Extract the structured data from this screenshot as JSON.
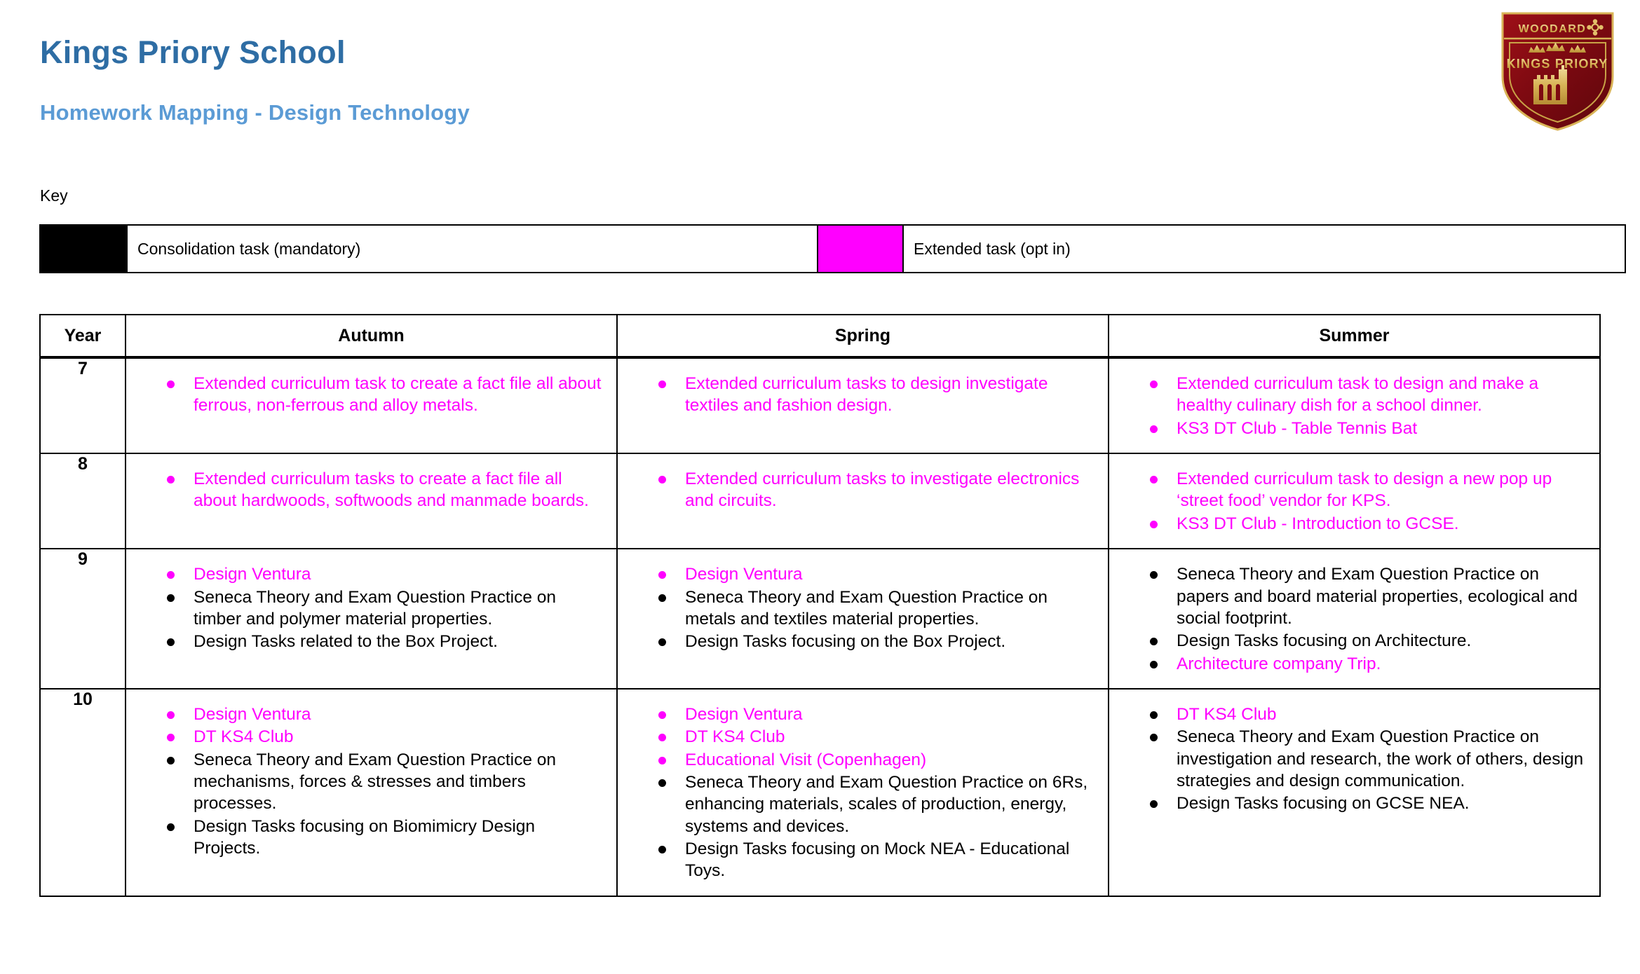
{
  "header": {
    "school_name": "Kings Priory School",
    "document_title": "Homework Mapping - Design Technology",
    "logo": {
      "top_text": "WOODARD",
      "name_text": "KINGS PRIORY"
    }
  },
  "key": {
    "label": "Key",
    "items": [
      {
        "color": "#000000",
        "label": "Consolidation task (mandatory)"
      },
      {
        "color": "#FF00FF",
        "label": "Extended task (opt in)"
      }
    ]
  },
  "table": {
    "headers": [
      "Year",
      "Autumn",
      "Spring",
      "Summer"
    ],
    "rows": [
      {
        "year": "7",
        "autumn": [
          {
            "text": "Extended curriculum task to create a fact file all about ferrous, non-ferrous and alloy metals.",
            "style": "magenta"
          }
        ],
        "spring": [
          {
            "text": "Extended curriculum tasks to design investigate textiles and fashion design.",
            "style": "magenta"
          }
        ],
        "summer": [
          {
            "text": "Extended curriculum task to design and make a healthy culinary dish for a school dinner.",
            "style": "magenta"
          },
          {
            "text": "KS3 DT Club - Table Tennis Bat",
            "style": "magenta"
          }
        ]
      },
      {
        "year": "8",
        "autumn": [
          {
            "text": "Extended curriculum tasks to create a fact file all about hardwoods, softwoods and manmade boards.",
            "style": "magenta"
          }
        ],
        "spring": [
          {
            "text": "Extended curriculum tasks to investigate electronics and circuits.",
            "style": "magenta"
          }
        ],
        "summer": [
          {
            "text": "Extended curriculum task to design a new pop up ‘street food’ vendor for KPS.",
            "style": "magenta"
          },
          {
            "text": "KS3 DT Club - Introduction to GCSE.",
            "style": "magenta"
          }
        ]
      },
      {
        "year": "9",
        "autumn": [
          {
            "text": "Design Ventura",
            "style": "magenta"
          },
          {
            "text": "Seneca Theory and Exam Question Practice on timber and polymer material properties.",
            "style": "black"
          },
          {
            "text": "Design Tasks related to the Box Project.",
            "style": "black"
          }
        ],
        "spring": [
          {
            "text": "Design Ventura",
            "style": "magenta"
          },
          {
            "text": "Seneca Theory and Exam Question Practice on metals and textiles material properties.",
            "style": "black"
          },
          {
            "text": "Design Tasks focusing on the Box Project.",
            "style": "black"
          }
        ],
        "summer": [
          {
            "text": "Seneca Theory and Exam Question Practice on papers and board material properties, ecological and social footprint.",
            "style": "black"
          },
          {
            "text": "Design Tasks focusing on Architecture.",
            "style": "black"
          },
          {
            "text": "Architecture company Trip.",
            "style": "magenta-text-black-bullet"
          }
        ]
      },
      {
        "year": "10",
        "autumn": [
          {
            "text": "Design Ventura",
            "style": "magenta"
          },
          {
            "text": "DT KS4 Club",
            "style": "magenta"
          },
          {
            "text": "Seneca Theory and Exam Question Practice on mechanisms, forces & stresses and timbers processes.",
            "style": "black"
          },
          {
            "text": "Design Tasks focusing on Biomimicry Design Projects.",
            "style": "black"
          }
        ],
        "spring": [
          {
            "text": "Design Ventura",
            "style": "magenta"
          },
          {
            "text": "DT KS4 Club",
            "style": "magenta"
          },
          {
            "text": "Educational Visit (Copenhagen)",
            "style": "magenta"
          },
          {
            "text": "Seneca Theory and Exam Question Practice on 6Rs, enhancing materials, scales of production, energy, systems and devices.",
            "style": "black"
          },
          {
            "text": "Design Tasks focusing on Mock NEA - Educational Toys.",
            "style": "black"
          }
        ],
        "summer": [
          {
            "text": "DT KS4 Club",
            "style": "magenta-text-black-bullet"
          },
          {
            "text": "Seneca Theory and Exam Question Practice on investigation and research, the work of others, design strategies and design communication.",
            "style": "black"
          },
          {
            "text": "Design Tasks focusing on GCSE NEA.",
            "style": "black"
          }
        ]
      }
    ]
  },
  "colors": {
    "title": "#2E6DA4",
    "subtitle": "#5B9BD5",
    "extended": "#FF00FF",
    "consolidation": "#000000",
    "crest_dark": "#8B0C13",
    "crest_gold": "#E8C870"
  }
}
